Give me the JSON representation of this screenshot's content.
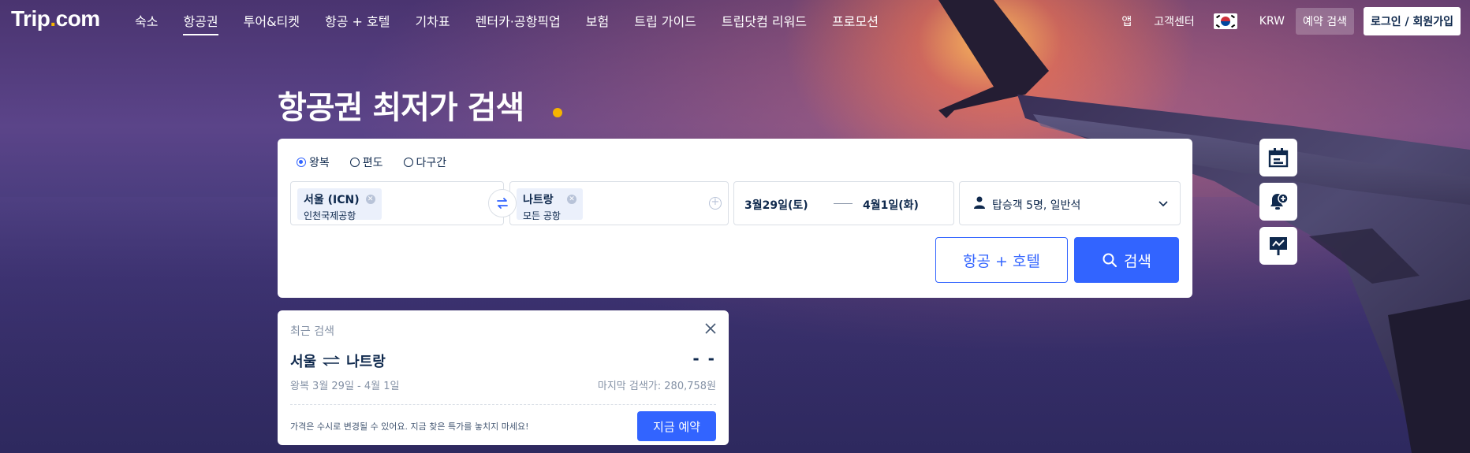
{
  "brand": {
    "logo_text": "Trip",
    "logo_dot": ".",
    "logo_suffix": "com",
    "accent": "#f5b400",
    "primary": "#3264ff"
  },
  "nav": {
    "items": [
      "숙소",
      "항공권",
      "투어&티켓",
      "항공 + 호텔",
      "기차표",
      "렌터카·공항픽업",
      "보험",
      "트립 가이드",
      "트립닷컴 리워드",
      "프로모션"
    ],
    "active_index": 1,
    "app": "앱",
    "support": "고객센터",
    "currency": "KRW",
    "booking_search": "예약 검색",
    "login": "로그인 / 회원가입"
  },
  "hero": {
    "title": "항공권 최저가 검색"
  },
  "search": {
    "trip_types": [
      "왕복",
      "편도",
      "다구간"
    ],
    "selected_trip_type": 0,
    "origin": {
      "city": "서울 (ICN)",
      "airport": "인천국제공항"
    },
    "destination": {
      "city": "나트랑",
      "airport": "모든 공항"
    },
    "depart_date": "3월29일(토)",
    "return_date": "4월1일(화)",
    "passengers": "탑승객 5명, 일반석",
    "hotel_button": "항공 + 호텔",
    "search_button": "검색"
  },
  "side_tools": [
    "calendar-icon",
    "price-alert-icon",
    "price-trend-icon"
  ],
  "recent": {
    "heading": "최근 검색",
    "from": "서울",
    "to": "나트랑",
    "price": "- -",
    "meta": "왕복  3월 29일 - 4월 1일",
    "last_price": "마지막 검색가: 280,758원",
    "notice": "가격은 수시로 변경될 수 있어요. 지금 찾은 특가를 놓치지 마세요!",
    "book_button": "지금 예약"
  }
}
